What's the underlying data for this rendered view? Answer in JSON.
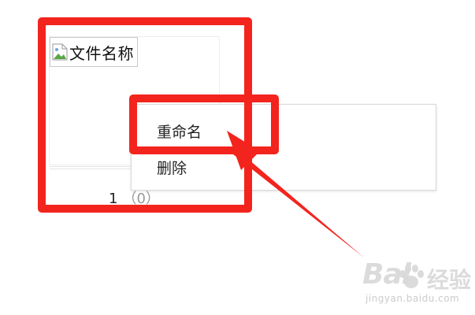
{
  "file_item": {
    "thumbnail_alt_text": "文件名称",
    "count_number": "1",
    "count_paren": "（0）"
  },
  "context_menu": {
    "items": [
      {
        "label": "重命名"
      },
      {
        "label": "删除"
      }
    ]
  },
  "annotation": {
    "color": "#f3241d"
  },
  "watermark": {
    "logo_text": "Bai",
    "logo_suffix": "经验",
    "url": "jingyan.baidu.com"
  }
}
